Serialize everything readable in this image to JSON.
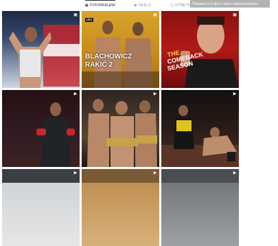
{
  "tabs": [
    {
      "label": "ПУБЛИКАЦИИ",
      "icon": "grid-icon",
      "active": true
    },
    {
      "label": "REELS",
      "icon": "reels-icon",
      "active": false
    },
    {
      "label": "ОТМЕТКИ",
      "icon": "tagged-icon",
      "active": false
    }
  ],
  "tooltip": "Перемести в фото через перетаскивание",
  "posts": [
    {
      "badge": "clip-icon"
    },
    {
      "badge": "clip-icon",
      "poster_logo": "UFC",
      "poster_line1": "BLACHOWICZ",
      "poster_line2": "RAKIĆ 2"
    },
    {
      "badge": "clip-icon",
      "poster_line1": "THE",
      "poster_line2": "COMEBACK",
      "poster_line3": "SEASON"
    },
    {
      "badge": "reels-icon"
    },
    {
      "badge": "reels-icon"
    },
    {
      "badge": "reels-icon"
    },
    {
      "badge": "reels-icon"
    },
    {
      "badge": "reels-icon"
    },
    {
      "badge": "reels-icon"
    }
  ]
}
